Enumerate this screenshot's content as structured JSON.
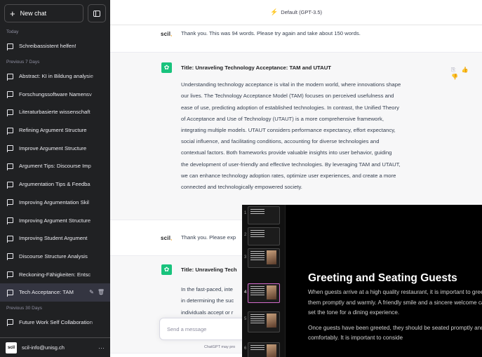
{
  "sidebar": {
    "new_chat": "New chat",
    "groups": {
      "today": "Today",
      "prev7": "Previous 7 Days",
      "prev30": "Previous 30 Days"
    },
    "today_items": [
      "Schreibassistent helfen!"
    ],
    "prev7_items": [
      "Abstract: KI in Bildung analysie",
      "Forschungssoftware Namensv",
      "Literaturbasierte wissenschaft",
      "Refining Argument Structure",
      "Improve Argument Structure",
      "Argument Tips: Discourse Imp",
      "Argumentation Tips & Feedba",
      "Improving Argumentation Skil",
      "Improving Argument Structure",
      "Improving Student Argument",
      "Discourse Structure Analysis",
      "Reckoning-Fähigkeiten: Entsc",
      "Tech Acceptance: TAM"
    ],
    "prev30_items": [
      "Future Work Self Collaboration"
    ],
    "user_email": "scil-info@unisg.ch",
    "user_logo": "scil",
    "more": "···"
  },
  "main": {
    "model_label": "Default (GPT-3.5)",
    "user_logo": "scil",
    "messages": [
      {
        "role": "user",
        "text": "Thank you. This was 94 words. Please try again and take about 150 words."
      },
      {
        "role": "assistant",
        "title": "Title: Unraveling Technology Acceptance: TAM and UTAUT",
        "lines": [
          "Understanding technology acceptance is vital in the modern world, where innovations shape",
          "our lives. The Technology Acceptance Model (TAM) focuses on perceived usefulness and",
          "ease of use, predicting adoption of established technologies. In contrast, the Unified Theory",
          "of Acceptance and Use of Technology (UTAUT) is a more comprehensive framework,",
          "integrating multiple models. UTAUT considers performance expectancy, effort expectancy,",
          "social influence, and facilitating conditions, accounting for diverse technologies and",
          "contextual factors. Both frameworks provide valuable insights into user behavior, guiding",
          "the development of user-friendly and effective technologies. By leveraging TAM and UTAUT,",
          "we can enhance technology adoption rates, optimize user experiences, and create a more",
          "connected and technologically empowered society."
        ]
      },
      {
        "role": "user",
        "text": "Thank you. Please exp"
      },
      {
        "role": "assistant",
        "title": "Title: Unraveling Tech",
        "lines": [
          "In the fast-paced, inte",
          "in determining the suc",
          "individuals accept or r"
        ]
      }
    ],
    "composer_placeholder": "Send a message",
    "footer": "ChatGPT may pro"
  },
  "overlay": {
    "thumbnail_numbers": [
      "1",
      "2",
      "3",
      "4",
      "5",
      "6"
    ],
    "slide_title": "Greeting and Seating Guests",
    "paragraphs": [
      "When guests arrive at a high quality restaurant, it is important to greet them promptly and warmly. A friendly smile and a sincere welcome can set the tone for a dining experience.",
      "Once guests have been greeted, they should be seated promptly and comfortably. It is important to conside"
    ]
  }
}
